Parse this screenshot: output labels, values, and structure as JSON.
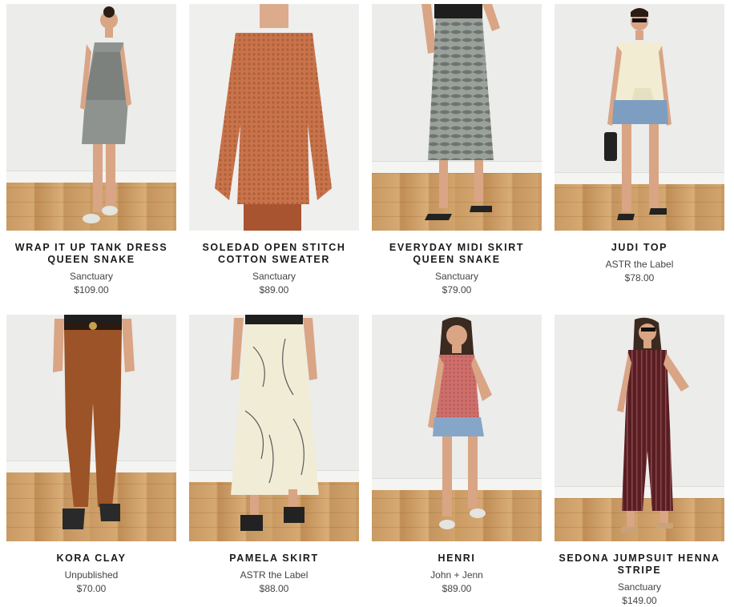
{
  "products": [
    {
      "title": "WRAP IT UP TANK DRESS QUEEN SNAKE",
      "brand": "Sanctuary",
      "price": "$109.00",
      "image": "model-in-snakeskin-tank-dress"
    },
    {
      "title": "SOLEDAD OPEN STITCH COTTON SWEATER",
      "brand": "Sanctuary",
      "price": "$89.00",
      "image": "rust-open-knit-sweater"
    },
    {
      "title": "EVERYDAY MIDI SKIRT QUEEN SNAKE",
      "brand": "Sanctuary",
      "price": "$79.00",
      "image": "snake-print-midi-skirt"
    },
    {
      "title": "JUDI TOP",
      "brand": "ASTR the Label",
      "price": "$78.00",
      "image": "model-in-cream-tie-top"
    },
    {
      "title": "KORA CLAY",
      "brand": "Unpublished",
      "price": "$70.00",
      "image": "rust-skinny-jeans"
    },
    {
      "title": "PAMELA SKIRT",
      "brand": "ASTR the Label",
      "price": "$88.00",
      "image": "cream-printed-midi-skirt"
    },
    {
      "title": "HENRI",
      "brand": "John + Jenn",
      "price": "$89.00",
      "image": "model-in-pink-knit-tank"
    },
    {
      "title": "SEDONA JUMPSUIT HENNA STRIPE",
      "brand": "Sanctuary",
      "price": "$149.00",
      "image": "model-in-striped-jumpsuit"
    }
  ]
}
